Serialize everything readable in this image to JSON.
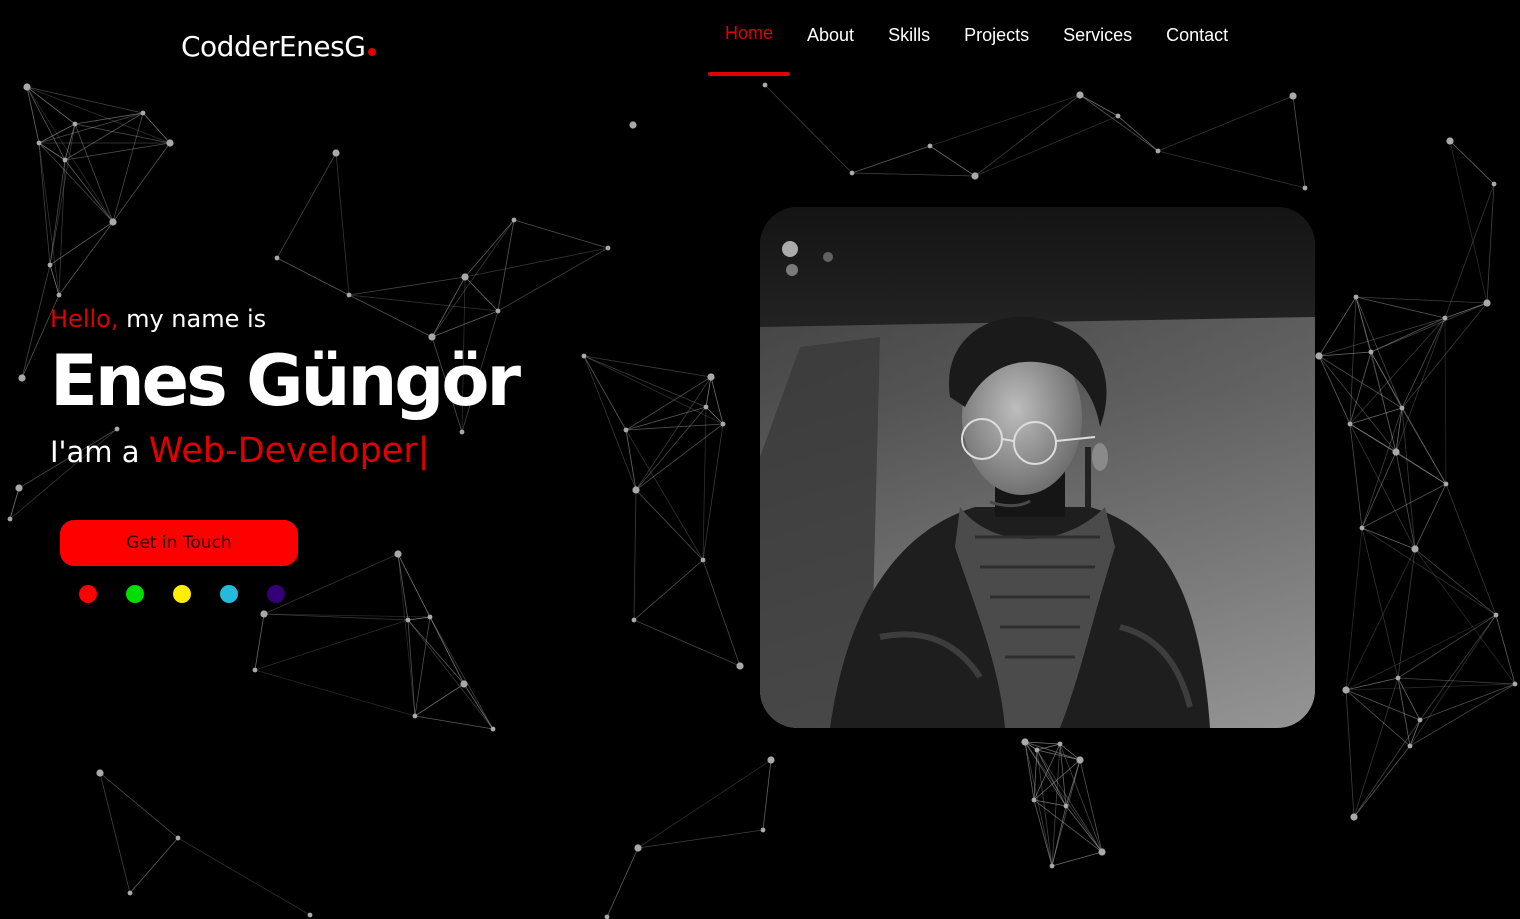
{
  "logo": {
    "text": "CodderEnesG",
    "dot_color": "#e00000"
  },
  "nav": {
    "items": [
      {
        "label": "Home",
        "active": true
      },
      {
        "label": "About",
        "active": false
      },
      {
        "label": "Skills",
        "active": false
      },
      {
        "label": "Projects",
        "active": false
      },
      {
        "label": "Services",
        "active": false
      },
      {
        "label": "Contact",
        "active": false
      }
    ]
  },
  "hero": {
    "greeting_accent": "Hello,",
    "greeting_rest": " my name is",
    "name": "Enes Güngör",
    "role_prefix": "I'am a ",
    "role": "Web-Developer|",
    "cta_label": "Get in Touch"
  },
  "theme_swatches": [
    "#ff0000",
    "#00dd00",
    "#ffee00",
    "#22bbdd",
    "#330077"
  ],
  "colors": {
    "accent": "#e00000",
    "background": "#000000",
    "button": "#ff0000"
  }
}
